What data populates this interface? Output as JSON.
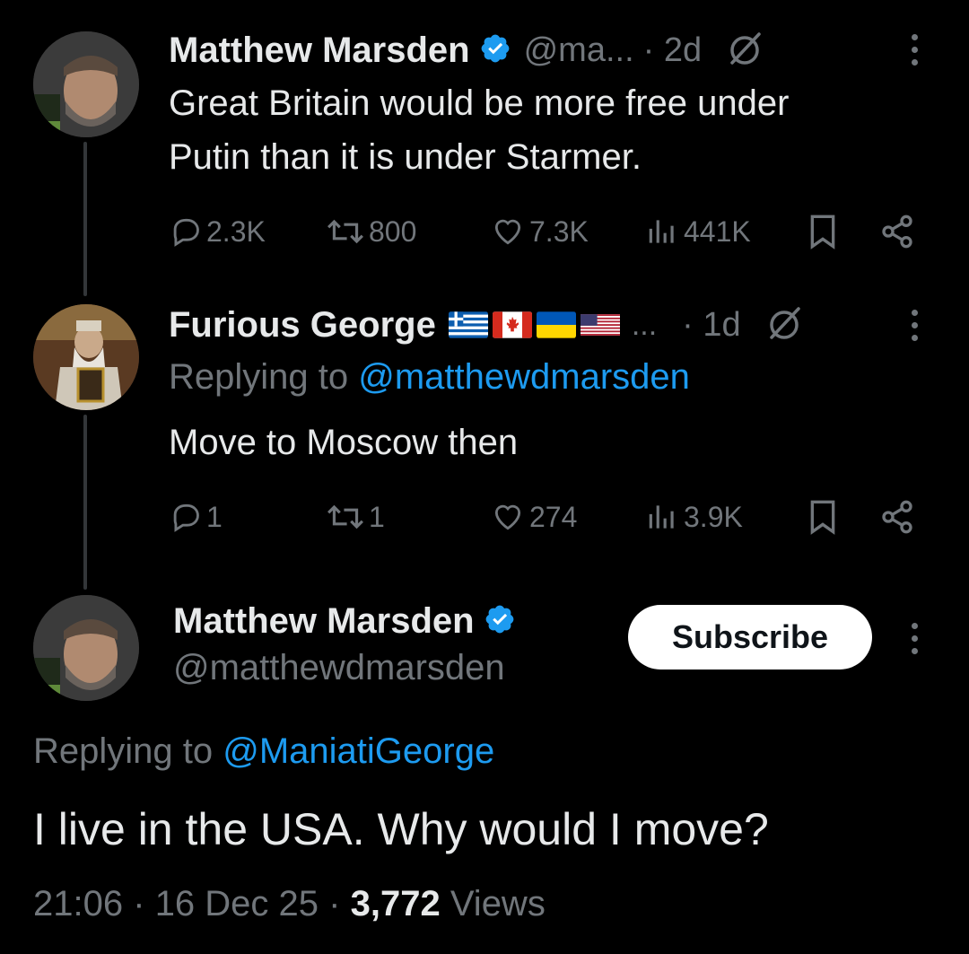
{
  "tweet1": {
    "name": "Matthew Marsden",
    "handle": "@ma...",
    "time": "· 2d",
    "text_line1": "Great Britain would be more free under",
    "text_line2": "Putin than it is under Starmer.",
    "replies": "2.3K",
    "retweets": "800",
    "likes": "7.3K",
    "views": "441K"
  },
  "tweet2": {
    "name": "Furious George",
    "name_suffix": "...",
    "time": "· 1d",
    "replying_label": "Replying to",
    "replying_handle": "@matthewdmarsden",
    "text": "Move to Moscow then",
    "replies": "1",
    "retweets": "1",
    "likes": "274",
    "views": "3.9K"
  },
  "main_tweet": {
    "name": "Matthew Marsden",
    "handle": "@matthewdmarsden",
    "subscribe_label": "Subscribe",
    "replying_label": "Replying to",
    "replying_handle": "@ManiatiGeorge",
    "text": "I live in the USA. Why would I move?",
    "time": "21:06",
    "date": "16 Dec 25",
    "view_count": "3,772",
    "view_label": "Views"
  },
  "colors": {
    "background": "#000000",
    "text": "#e7e9ea",
    "muted": "#71767b",
    "link": "#1d9bf0",
    "verified": "#1d9bf0"
  }
}
